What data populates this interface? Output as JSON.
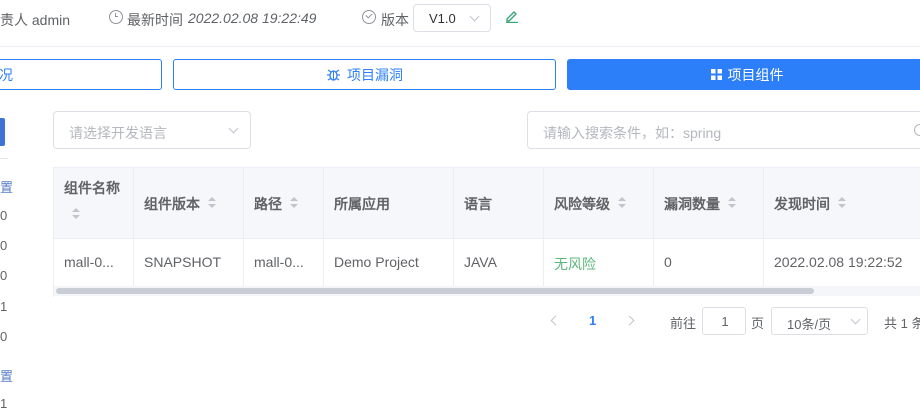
{
  "header": {
    "owner_label": "责人 admin",
    "time_label": "最新时间",
    "time_value": "2022.02.08 19:22:49",
    "version_label": "版本",
    "version_value": "V1.0"
  },
  "tabs": {
    "overview": "况",
    "vulnerabilities": "项目漏洞",
    "components": "项目组件"
  },
  "sidebar": {
    "items": [
      "置",
      "0",
      "0",
      "0",
      "1",
      "0",
      "置",
      "1"
    ]
  },
  "filters": {
    "language_placeholder": "请选择开发语言",
    "search_placeholder": "请输入搜索条件，如：spring"
  },
  "table": {
    "headers": [
      "组件名称",
      "组件版本",
      "路径",
      "所属应用",
      "语言",
      "风险等级",
      "漏洞数量",
      "发现时间"
    ],
    "rows": [
      [
        "mall-0...",
        "SNAPSHOT",
        "mall-0...",
        "Demo Project",
        "JAVA",
        "无风险",
        "0",
        "2022.02.08 19:22:52"
      ]
    ]
  },
  "pagination": {
    "current_page": "1",
    "goto_label": "前往",
    "goto_value": "1",
    "page_unit": "页",
    "page_size": "10条/页",
    "total_label": "共 1 条"
  },
  "colors": {
    "primary": "#2d7ff9",
    "risk_none": "#5cb87a"
  }
}
